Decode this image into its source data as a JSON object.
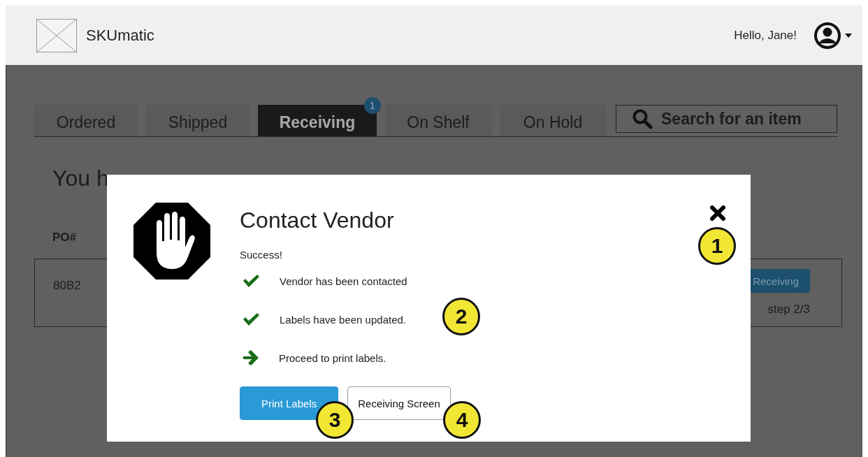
{
  "header": {
    "app_name": "SKUmatic",
    "greeting": "Hello, Jane!"
  },
  "tabs": [
    {
      "label": "Ordered",
      "selected": false
    },
    {
      "label": "Shipped",
      "selected": false
    },
    {
      "label": "Receiving",
      "selected": true,
      "badge": "1"
    },
    {
      "label": "On Shelf",
      "selected": false
    },
    {
      "label": "On Hold",
      "selected": false
    }
  ],
  "search": {
    "placeholder": "Search for an item"
  },
  "heading": "You h",
  "table": {
    "columns": [
      "PO#"
    ],
    "rows": [
      {
        "po": "80B2",
        "action": "Receiving",
        "step": "step 2/3"
      }
    ]
  },
  "dialog": {
    "title": "Contact Vendor",
    "status": "Success!",
    "items": [
      {
        "kind": "done",
        "text": "Vendor has been contacted"
      },
      {
        "kind": "done",
        "text": "Labels have been updated."
      },
      {
        "kind": "next",
        "text": "Proceed to print labels."
      }
    ],
    "buttons": [
      {
        "label": "Print Labels",
        "primary": true
      },
      {
        "label": "Receiving Screen",
        "primary": false
      }
    ]
  },
  "annotations": [
    "1",
    "2",
    "3",
    "4"
  ]
}
